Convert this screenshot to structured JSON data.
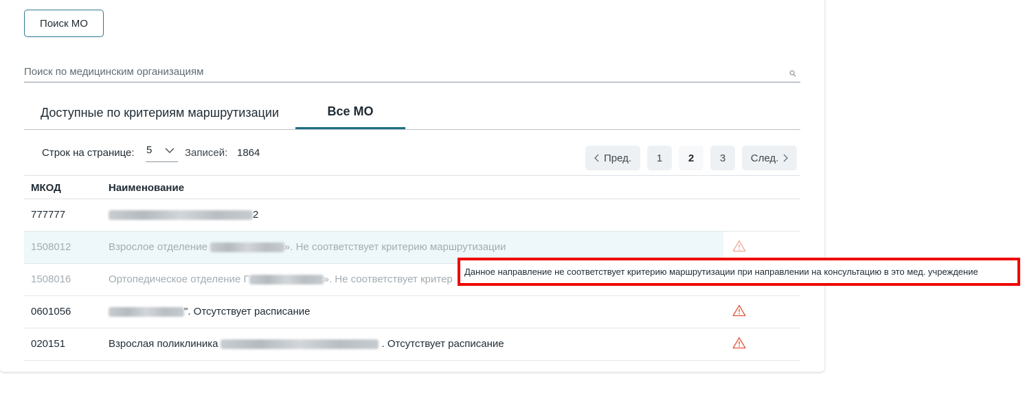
{
  "search_mo_button": "Поиск МО",
  "search": {
    "placeholder": "Поиск по медицинским организациям"
  },
  "tabs": [
    {
      "label": "Доступные по критериям маршрутизации",
      "active": false
    },
    {
      "label": "Все МО",
      "active": true
    }
  ],
  "pager": {
    "rows_label": "Строк на странице:",
    "rows_value": "5",
    "records_label": "Записей:",
    "records_count": "1864",
    "prev": "Пред.",
    "pages": [
      "1",
      "2",
      "3"
    ],
    "current_page": "2",
    "next": "След."
  },
  "table": {
    "headers": {
      "code": "МКОД",
      "name": "Наименование"
    },
    "rows": [
      {
        "code": "777777",
        "name_prefix": "",
        "name_suffix": "2",
        "dimmed": false,
        "warning": false
      },
      {
        "code": "1508012",
        "name_prefix": "Взрослое отделение",
        "name_suffix": "». Не соответствует критерию маршрутизации",
        "dimmed": true,
        "warning": true
      },
      {
        "code": "1508016",
        "name_prefix": "Ортопедическое отделение Г",
        "name_suffix": "». Не соответствует критер",
        "dimmed": true,
        "warning": true
      },
      {
        "code": "0601056",
        "name_prefix": "",
        "name_suffix": "\". Отсутствует расписание",
        "dimmed": false,
        "warning": true
      },
      {
        "code": "020151",
        "name_prefix": "Взрослая поликлиника",
        "name_suffix": ". Отсутствует расписание",
        "dimmed": false,
        "warning": true
      }
    ]
  },
  "tooltip": "Данное направление не соответствует критерию маршрутизации при направлении на консультацию в это мед. учреждение",
  "colors": {
    "accent": "#1d6f80",
    "warning": "#e0553a",
    "highlight_border": "#ee0000"
  }
}
